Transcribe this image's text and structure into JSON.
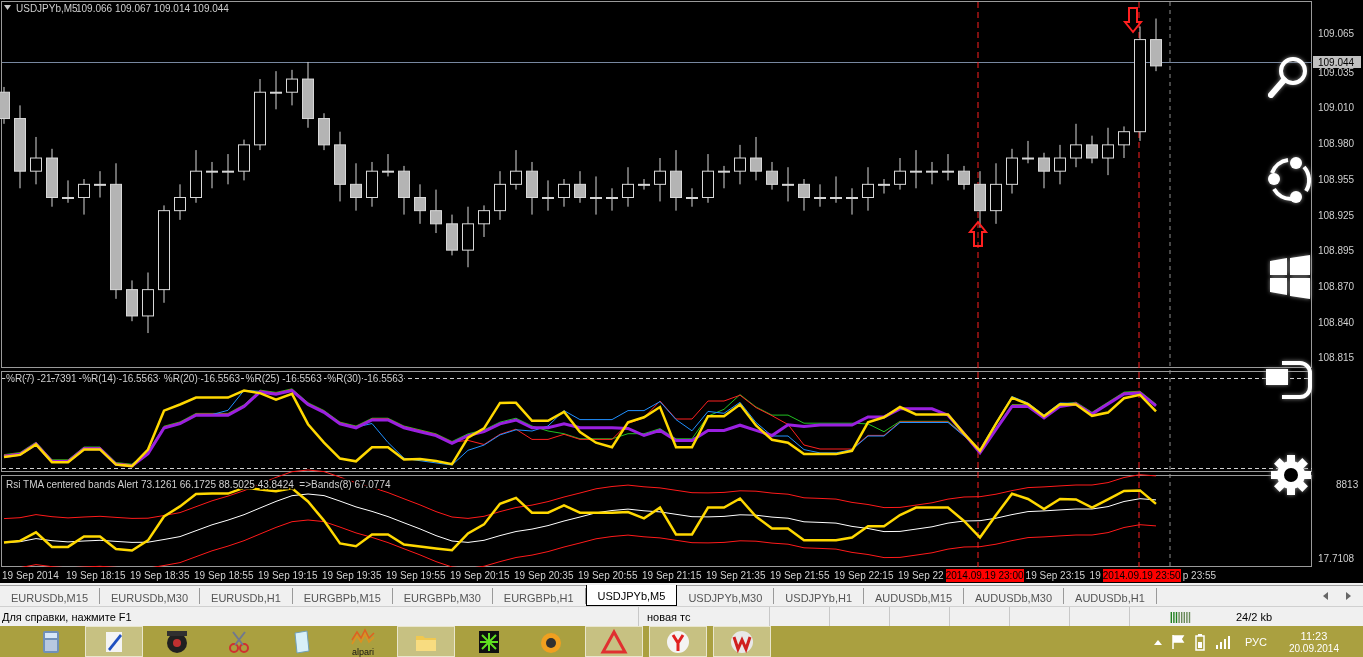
{
  "chart": {
    "title": "USDJPYb,M5",
    "ohlc": "109.066 109.067 109.014 109.044",
    "price_labels": [
      "109.065",
      "109.035",
      "109.010",
      "108.980",
      "108.955",
      "108.925",
      "108.895",
      "108.870",
      "108.840",
      "108.815"
    ],
    "current_price": "109.044"
  },
  "wpr_panel": {
    "legend": "%R(7) -21.7391  %R(14) -16.5563  %R(20) -16.5563  %R(25) -16.5563  %R(30) -16.5563"
  },
  "rsi_panel": {
    "legend": "Rsi TMA centered bands Alert 73.1261 66.1725 88.5025 43.8424  =>Bands(8) 67.0774",
    "axis_labels": [
      "8813",
      "17.7108"
    ]
  },
  "time_axis": [
    {
      "text": "19 Sep 2014",
      "kind": "tick"
    },
    {
      "text": "19 Sep 18:15",
      "kind": "tick"
    },
    {
      "text": "19 Sep 18:35",
      "kind": "tick"
    },
    {
      "text": "19 Sep 18:55",
      "kind": "tick"
    },
    {
      "text": "19 Sep 19:15",
      "kind": "tick"
    },
    {
      "text": "19 Sep 19:35",
      "kind": "tick"
    },
    {
      "text": "19 Sep 19:55",
      "kind": "tick"
    },
    {
      "text": "19 Sep 20:15",
      "kind": "tick"
    },
    {
      "text": "19 Sep 20:35",
      "kind": "tick"
    },
    {
      "text": "19 Sep 20:55",
      "kind": "tick"
    },
    {
      "text": "19 Sep 21:15",
      "kind": "tick"
    },
    {
      "text": "19 Sep 21:35",
      "kind": "tick"
    },
    {
      "text": "19 Sep 21:55",
      "kind": "tick"
    },
    {
      "text": "19 Sep 22:15",
      "kind": "tick"
    },
    {
      "text": "19 Sep 22",
      "kind": "partial"
    },
    {
      "text": "2014.09.19 23:00",
      "kind": "cursor"
    },
    {
      "text": "19 Sep 23:15",
      "kind": "tick"
    },
    {
      "text": "19",
      "kind": "partial"
    },
    {
      "text": "2014.09.19 23:50",
      "kind": "cursor"
    },
    {
      "text": "p 23:55",
      "kind": "partial"
    }
  ],
  "tabs": [
    {
      "label": "EURUSDb,M15",
      "selected": false
    },
    {
      "label": "EURUSDb,M30",
      "selected": false
    },
    {
      "label": "EURUSDb,H1",
      "selected": false
    },
    {
      "label": "EURGBPb,M15",
      "selected": false
    },
    {
      "label": "EURGBPb,M30",
      "selected": false
    },
    {
      "label": "EURGBPb,H1",
      "selected": false
    },
    {
      "label": "USDJPYb,M5",
      "selected": true
    },
    {
      "label": "USDJPYb,M30",
      "selected": false
    },
    {
      "label": "USDJPYb,H1",
      "selected": false
    },
    {
      "label": "AUDUSDb,M15",
      "selected": false
    },
    {
      "label": "AUDUSDb,M30",
      "selected": false
    },
    {
      "label": "AUDUSDb,H1",
      "selected": false
    }
  ],
  "status_bar": {
    "help": "Для справки, нажмите F1",
    "profile": "новая тс",
    "traffic": "24/2 kb"
  },
  "taskbar": {
    "apps": [
      {
        "kind": "calculator",
        "running": false
      },
      {
        "kind": "pen",
        "running": true
      },
      {
        "kind": "film",
        "running": false
      },
      {
        "kind": "scissors",
        "running": false
      },
      {
        "kind": "notepad",
        "running": false
      },
      {
        "kind": "zigzag",
        "running": false,
        "label": "alpari"
      },
      {
        "kind": "folder",
        "running": true
      },
      {
        "kind": "burst",
        "running": false
      },
      {
        "kind": "fruit",
        "running": false
      },
      {
        "kind": "triangle",
        "running": true
      },
      {
        "kind": "redcircle",
        "running": true
      },
      {
        "kind": "wcircle",
        "running": true
      }
    ],
    "tray": {
      "language": "РУС",
      "time": "11:23",
      "date": "20.09.2014"
    }
  }
}
